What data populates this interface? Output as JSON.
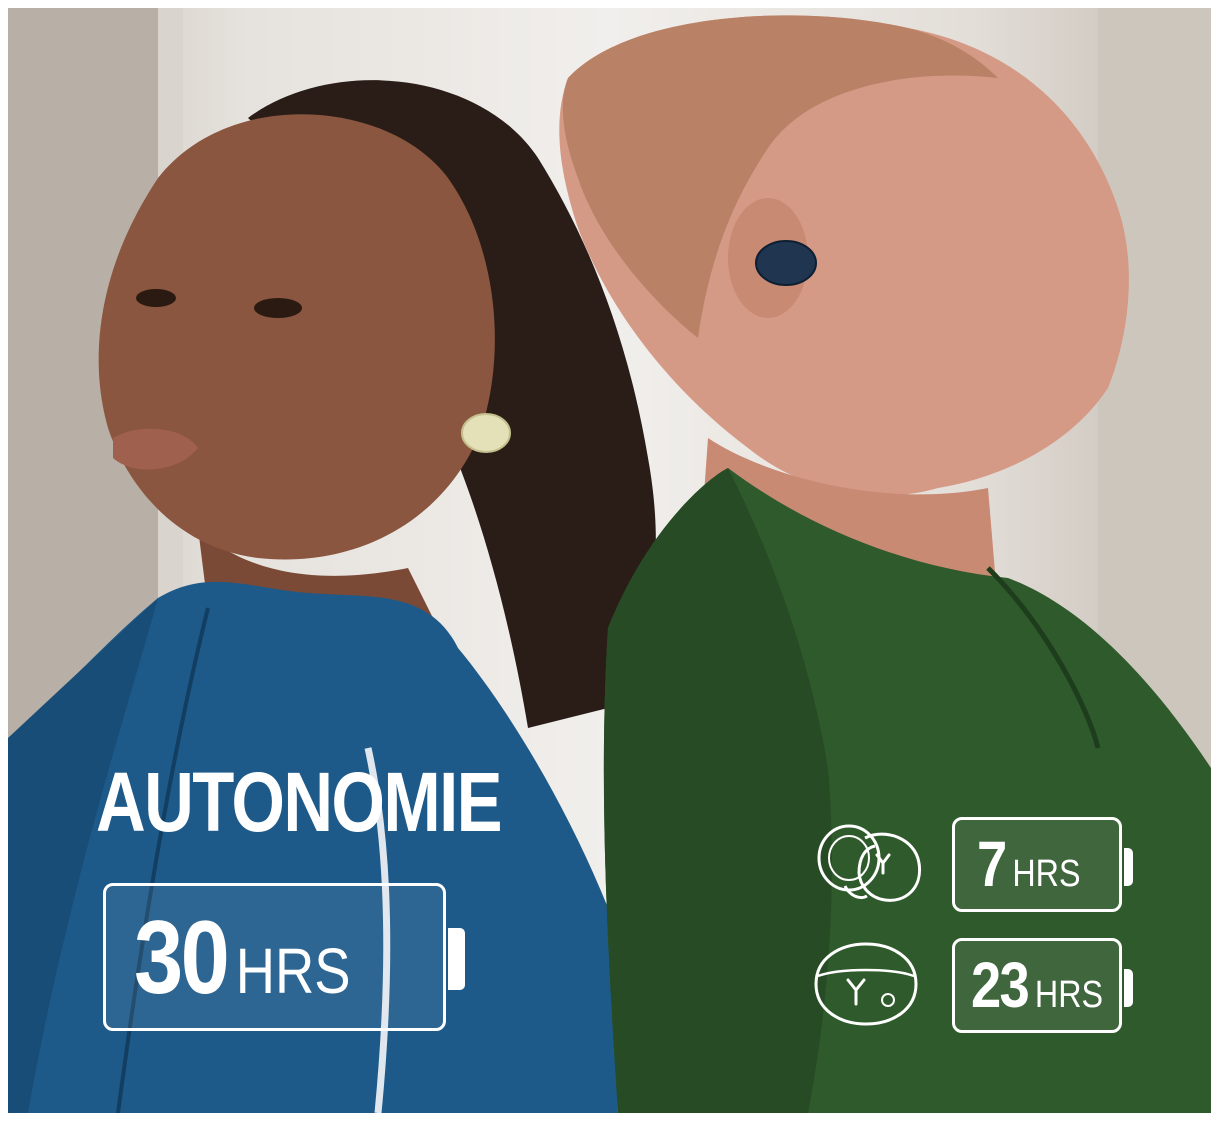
{
  "headline": "AUTONOMIE",
  "total_battery": {
    "value": "30",
    "unit": "HRS"
  },
  "earbuds_battery": {
    "value": "7",
    "unit": "HRS",
    "icon": "earbud-icon"
  },
  "case_battery": {
    "value": "23",
    "unit": "HRS",
    "icon": "charging-case-icon"
  },
  "colors": {
    "text": "#ffffff",
    "jacket_blue": "#1d5a8a",
    "shirt_green": "#2f5a2c"
  }
}
